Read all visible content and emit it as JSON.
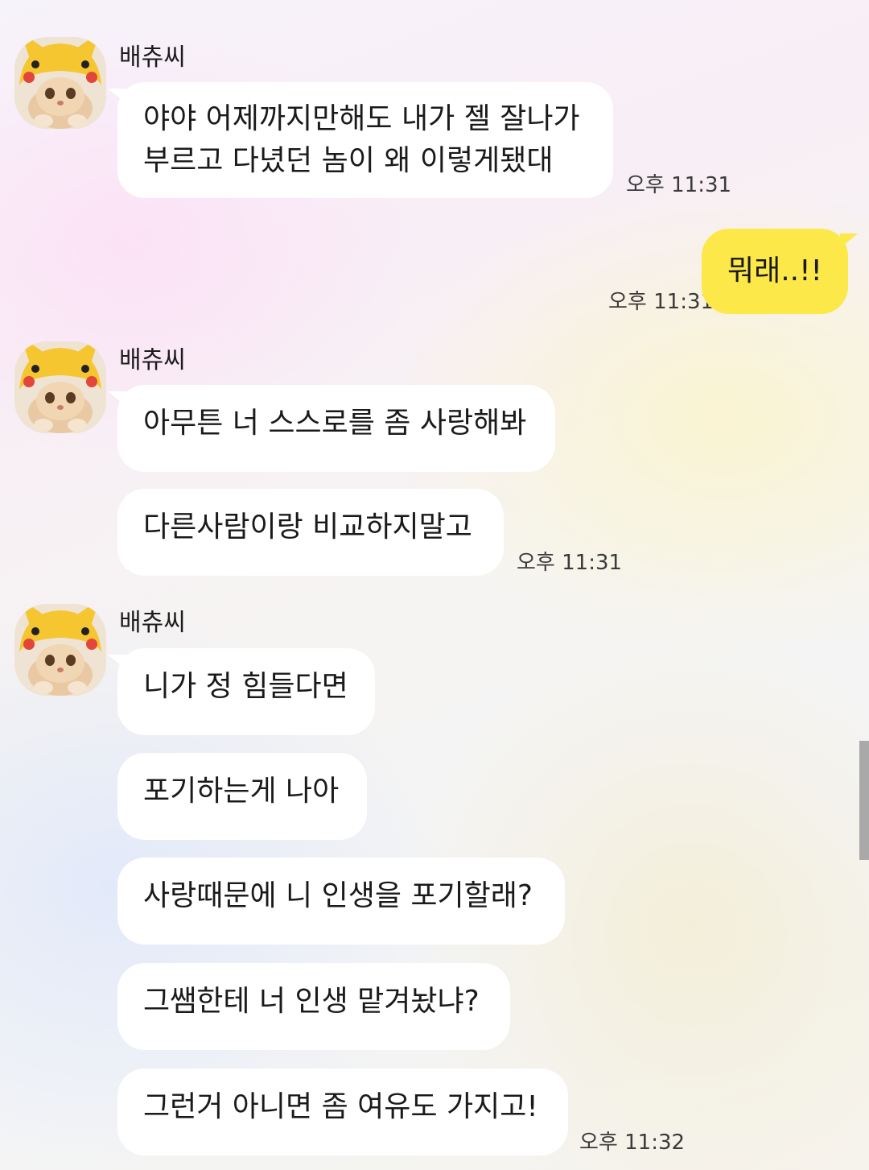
{
  "chat": {
    "sender_name": "배츄씨",
    "avatar_description": "cat-in-pikachu-hat-avatar",
    "colors": {
      "my_bubble": "#fde84a",
      "their_bubble": "#ffffff"
    },
    "messages": [
      {
        "from": "them",
        "text_line1": "야야 어제까지만해도 내가 젤 잘나가",
        "text_line2": "부르고 다녔던 놈이 왜 이렇게됐대",
        "time": "오후 11:31"
      },
      {
        "from": "me",
        "text": "뭐래..!!",
        "time": "오후 11:31"
      },
      {
        "from": "them",
        "text": "아무튼 너 스스로를 좀 사랑해봐"
      },
      {
        "from": "them",
        "text": "다른사람이랑 비교하지말고",
        "time": "오후 11:31"
      },
      {
        "from": "them",
        "text": "니가 정 힘들다면"
      },
      {
        "from": "them",
        "text": "포기하는게 나아"
      },
      {
        "from": "them",
        "text": "사랑때문에 니 인생을 포기할래?"
      },
      {
        "from": "them",
        "text": "그쌤한테 너 인생 맡겨놨냐?"
      },
      {
        "from": "them",
        "text": "그런거 아니면 좀 여유도 가지고!",
        "time": "오후 11:32"
      }
    ]
  }
}
